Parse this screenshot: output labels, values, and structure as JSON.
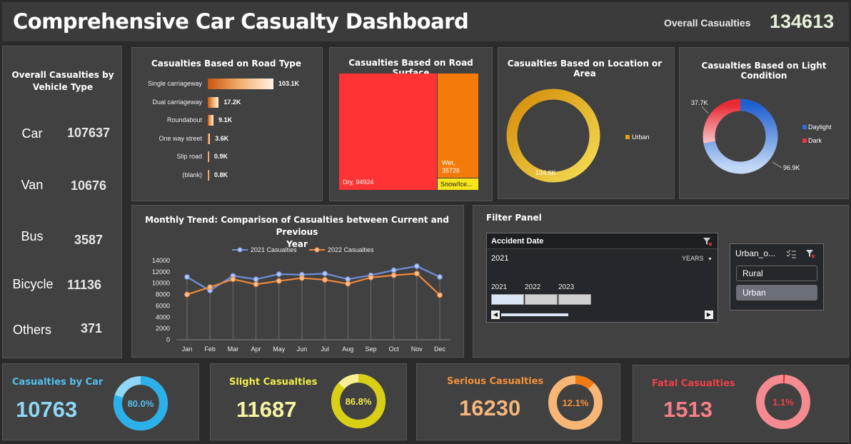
{
  "header": {
    "title": "Comprehensive Car Casualty Dashboard",
    "overall_label": "Overall Casualties",
    "overall_value": "134613"
  },
  "vehicle": {
    "title_line1": "Overall  Casualties by",
    "title_line2": "Vehicle Type",
    "items": [
      {
        "name": "Car",
        "value": "107637"
      },
      {
        "name": "Van",
        "value": "10676"
      },
      {
        "name": "Bus",
        "value": "3587"
      },
      {
        "name": "Bicycle",
        "value": "11136"
      },
      {
        "name": "Others",
        "value": "371"
      }
    ]
  },
  "chart_data": [
    {
      "type": "bar",
      "orientation": "horizontal",
      "title": "Casualties Based on Road Type",
      "categories": [
        "Single carriageway",
        "Dual carriageway",
        "Roundabout",
        "One way street",
        "Slip road",
        "(blank)"
      ],
      "values": [
        103.1,
        17.2,
        9.1,
        3.6,
        0.9,
        0.8
      ],
      "value_labels": [
        "103.1K",
        "17.2K",
        "9.1K",
        "3.6K",
        "0.9K",
        "0.8K"
      ],
      "units": "K"
    },
    {
      "type": "treemap",
      "title": "Casualties Based on Road Surface",
      "items": [
        {
          "name": "Dry",
          "value": 94924,
          "label": "Dry, 94924",
          "color": "#ff3333"
        },
        {
          "name": "Wet",
          "value": 35726,
          "label_line1": "Wet,",
          "label_line2": "35726",
          "color": "#f47a0a"
        },
        {
          "name": "Snow/Ice...",
          "value": 3963,
          "label": "Snow/Ice...",
          "color": "#f7e61a"
        }
      ]
    },
    {
      "type": "pie",
      "style": "donut",
      "title": "Casualties Based on Location or Area",
      "series": [
        {
          "name": "Urban",
          "value": 134.6,
          "label": "134.6K",
          "color": "#e0a00c"
        }
      ],
      "legend": [
        "Urban"
      ]
    },
    {
      "type": "pie",
      "style": "donut",
      "title": "Casualties Based on Light Condition",
      "series": [
        {
          "name": "Daylight",
          "value": 96.9,
          "label": "96.9K",
          "color": "#2a6fd6"
        },
        {
          "name": "Dark",
          "value": 37.7,
          "label": "37.7K",
          "color": "#ee3340"
        }
      ],
      "legend": [
        "Daylight",
        "Dark"
      ]
    },
    {
      "type": "line",
      "title_line1": "Monthly Trend: Comparison of Casualties between Current and Previous",
      "title_line2": "Year",
      "categories": [
        "Jan",
        "Feb",
        "Mar",
        "Apr",
        "May",
        "Jun",
        "Jul",
        "Aug",
        "Sep",
        "Oct",
        "Nov",
        "Dec"
      ],
      "series": [
        {
          "name": "2021 Casualties",
          "color": "#6f8fdc",
          "values": [
            11100,
            8700,
            11300,
            10700,
            11600,
            11500,
            11700,
            10700,
            11400,
            12300,
            13000,
            11100
          ]
        },
        {
          "name": "2022 Casualties",
          "color": "#f0883a",
          "values": [
            8000,
            9300,
            10700,
            9800,
            10400,
            10900,
            10600,
            9900,
            11000,
            11400,
            11700,
            7900
          ]
        }
      ],
      "ylim": [
        0,
        14000
      ],
      "yticks": [
        "14000",
        "12000",
        "10000",
        "8000",
        "6000",
        "4000",
        "2000",
        "0"
      ],
      "grid": false,
      "legend": "top"
    }
  ],
  "filter": {
    "title": "Filter Panel",
    "date_slicer": {
      "title": "Accident Date",
      "selected": "2021",
      "level": "YEARS",
      "years": [
        "2021",
        "2022",
        "2023"
      ]
    },
    "urban_slicer": {
      "title": "Urban_o...",
      "options": [
        "Rural",
        "Urban"
      ]
    }
  },
  "kpis": [
    {
      "title": "Casualties by Car",
      "value": "10763",
      "pct": "80.0%",
      "fraction": 0.8,
      "color": "#2bb0ea",
      "text_color": "#53c0ef",
      "val_color": "#8fd6f7",
      "track": "#8fd6f7"
    },
    {
      "title": "Slight  Casualties",
      "value": "11687",
      "pct": "86.8%",
      "fraction": 0.868,
      "color": "#d9cf14",
      "text_color": "#f2ec4b",
      "val_color": "#f6f3a3",
      "track": "#f4f093"
    },
    {
      "title": "Serious  Casualties",
      "value": "16230",
      "pct": "12.1%",
      "fraction": 0.121,
      "color": "#f07a14",
      "text_color": "#f5913a",
      "val_color": "#f6b67b",
      "track": "#f7b676"
    },
    {
      "title": "Fatal  Casualties",
      "value": "1513",
      "pct": "1.1%",
      "fraction": 0.011,
      "color": "#e3333a",
      "text_color": "#ee4049",
      "val_color": "#f57f87",
      "track": "#f58a90"
    }
  ]
}
